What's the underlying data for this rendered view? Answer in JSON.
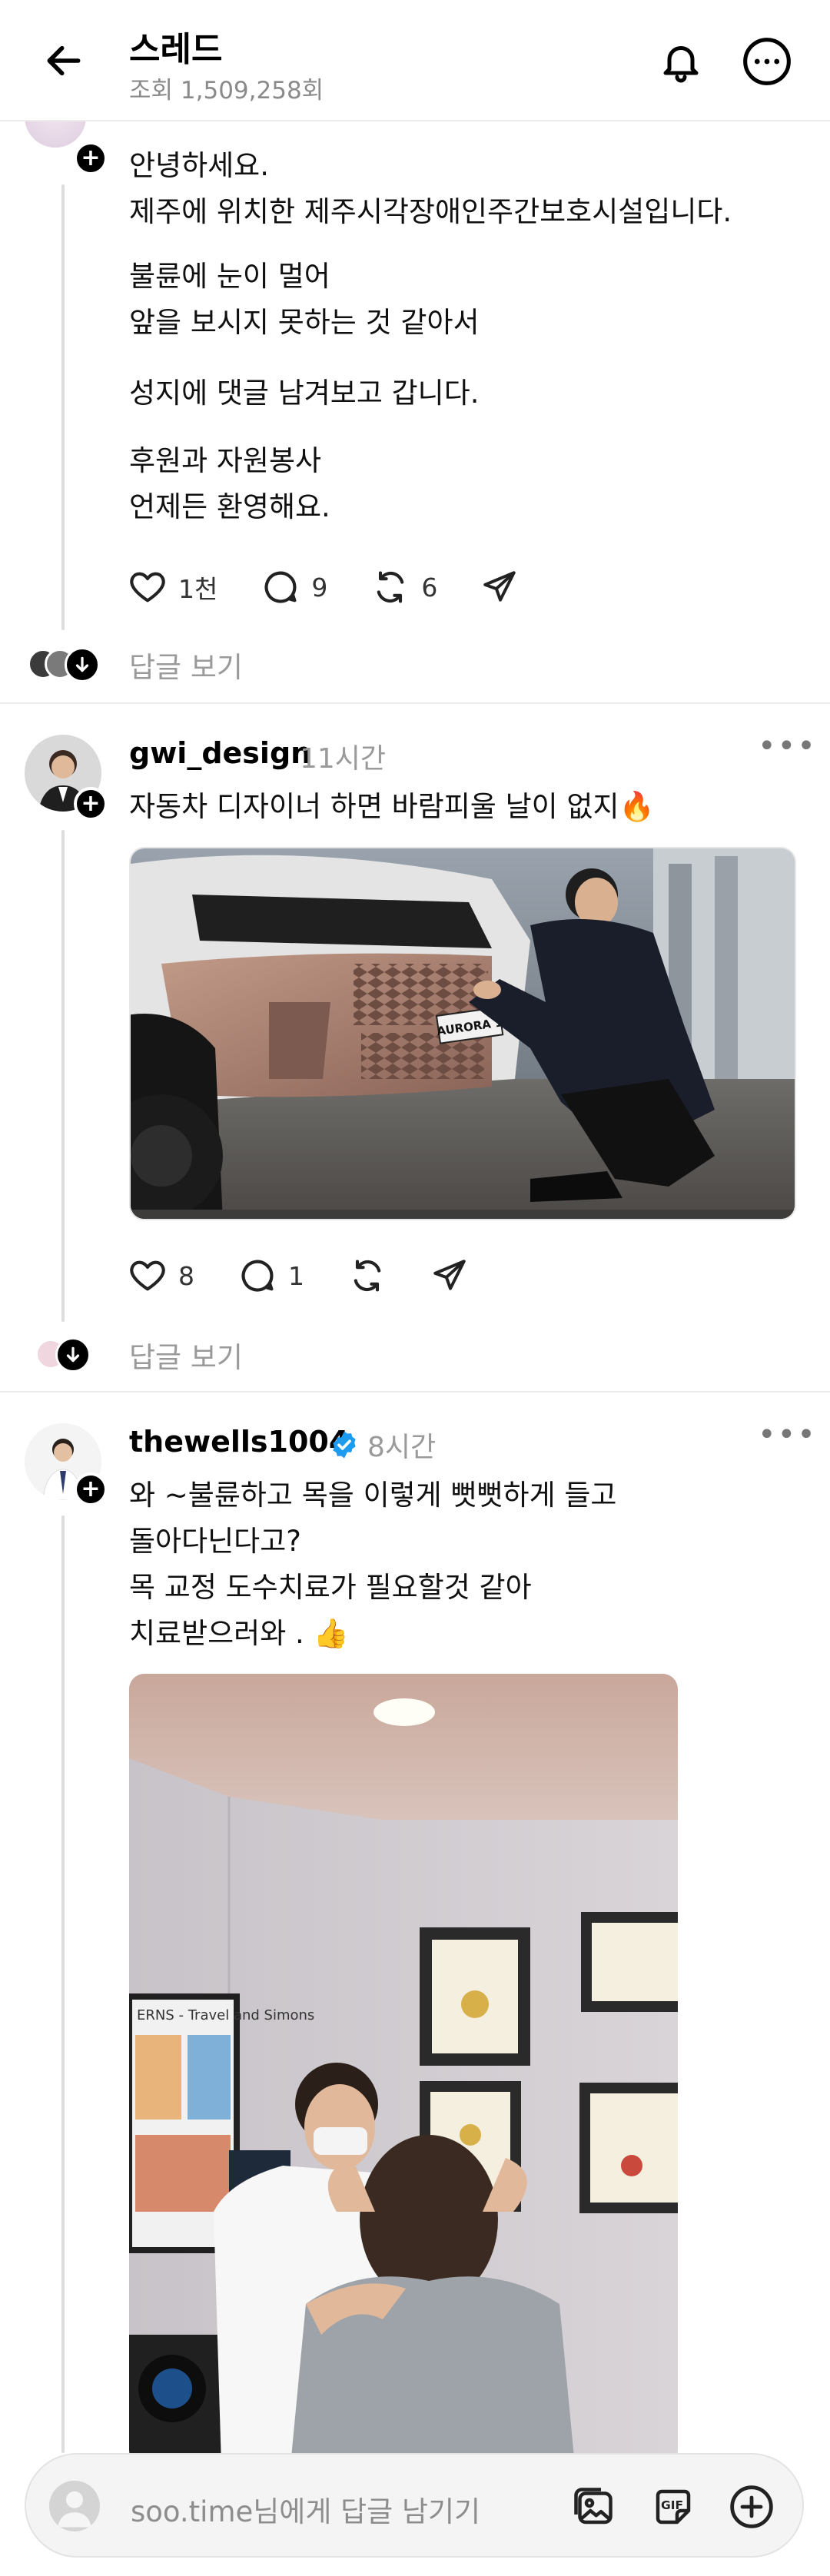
{
  "header": {
    "title": "스레드",
    "views": "조회 1,509,258회"
  },
  "post1": {
    "paragraphs": [
      "안녕하세요.\n제주에 위치한 제주시각장애인주간보호시설입니다.",
      "불륜에 눈이 멀어\n앞을 보시지 못하는 것 같아서",
      "성지에 댓글 남겨보고 갑니다.",
      "후원과 자원봉사\n언제든 환영해요."
    ],
    "likes": "1천",
    "comments": "9",
    "reposts": "6",
    "view_replies": "답글 보기"
  },
  "post2": {
    "username": "gwi_design",
    "time": "11시간",
    "text": "자동차 디자이너 하면 바람피울 날이 없지🔥",
    "image_plate_text": "AURORA 1",
    "likes": "8",
    "comments": "1",
    "view_replies": "답글 보기"
  },
  "post3": {
    "username": "thewells1004",
    "time": "8시간",
    "text": "와 ~불륜하고 목을 이렇게 뻣뻣하게 들고\n돌아다닌다고?\n목 교정 도수치료가 필요할것 같아\n치료받으러와 . 👍",
    "poster_text": "ERNS - Travel and Simons"
  },
  "composer": {
    "placeholder": "soo.time님에게 답글 남기기"
  },
  "icons": {
    "back": "arrow-left-icon",
    "bell": "bell-icon",
    "more": "more-circle-icon",
    "like": "heart-icon",
    "comment": "comment-icon",
    "repost": "repost-icon",
    "share": "send-icon",
    "verified": "verified-badge-icon",
    "image": "image-icon",
    "gif": "gif-icon",
    "plus": "plus-circle-icon"
  },
  "colors": {
    "verified": "#1d9bf0",
    "muted_text": "#9a9a9a",
    "divider": "#ececec"
  }
}
